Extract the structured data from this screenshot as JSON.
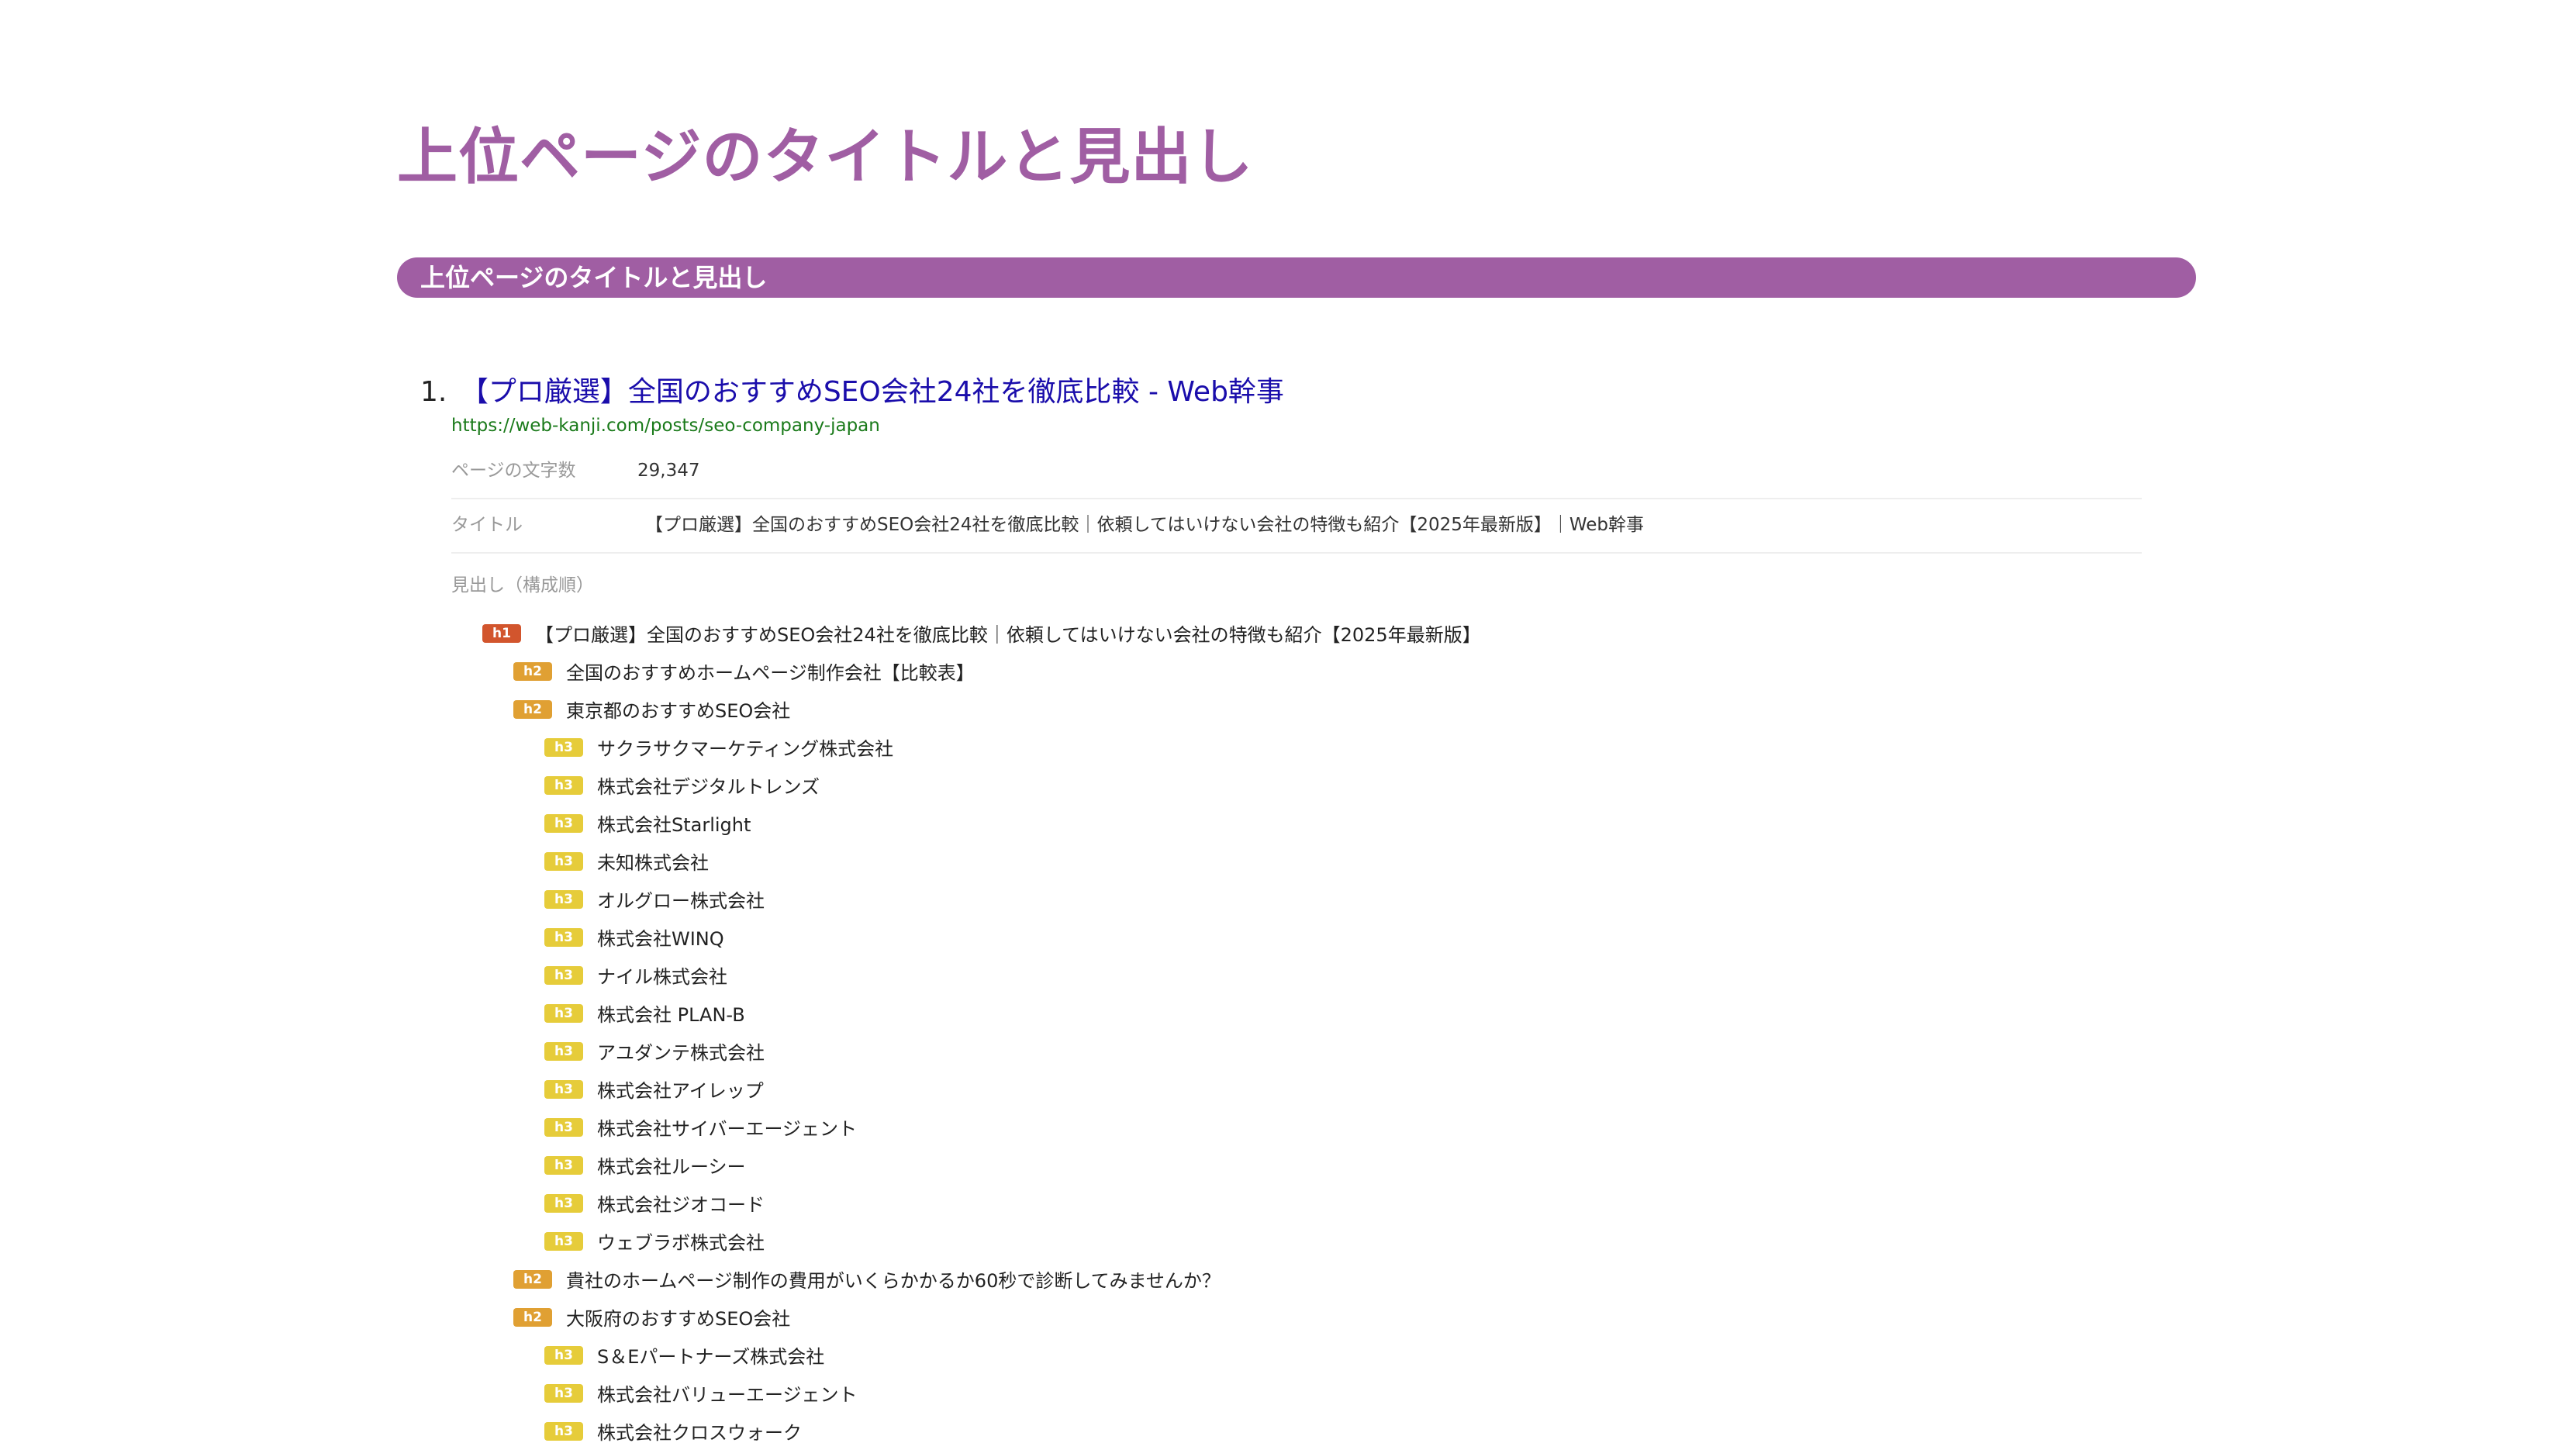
{
  "page": {
    "title": "上位ページのタイトルと見出し",
    "section_title": "上位ページのタイトルと見出し",
    "accent_color": "#a05ea3"
  },
  "results": [
    {
      "number": "1.",
      "title": "【プロ厳選】全国のおすすめSEO会社24社を徹底比較 - Web幹事",
      "url": "https://web-kanji.com/posts/seo-company-japan",
      "char_count_label": "ページの文字数",
      "char_count": "29,347",
      "page_title_label": "タイトル",
      "page_title": "【プロ厳選】全国のおすすめSEO会社24社を徹底比較｜依頼してはいけない会社の特徴も紹介【2025年最新版】｜Web幹事",
      "headings_label": "見出し（構成順）",
      "headings": [
        {
          "tag": "h1",
          "text": "【プロ厳選】全国のおすすめSEO会社24社を徹底比較｜依頼してはいけない会社の特徴も紹介【2025年最新版】"
        },
        {
          "tag": "h2",
          "text": "全国のおすすめホームページ制作会社【比較表】"
        },
        {
          "tag": "h2",
          "text": "東京都のおすすめSEO会社"
        },
        {
          "tag": "h3",
          "text": "サクラサクマーケティング株式会社"
        },
        {
          "tag": "h3",
          "text": "株式会社デジタルトレンズ"
        },
        {
          "tag": "h3",
          "text": "株式会社Starlight"
        },
        {
          "tag": "h3",
          "text": "未知株式会社"
        },
        {
          "tag": "h3",
          "text": "オルグロー株式会社"
        },
        {
          "tag": "h3",
          "text": "株式会社WINQ"
        },
        {
          "tag": "h3",
          "text": "ナイル株式会社"
        },
        {
          "tag": "h3",
          "text": "株式会社 PLAN-B"
        },
        {
          "tag": "h3",
          "text": "アユダンテ株式会社"
        },
        {
          "tag": "h3",
          "text": "株式会社アイレップ"
        },
        {
          "tag": "h3",
          "text": "株式会社サイバーエージェント"
        },
        {
          "tag": "h3",
          "text": "株式会社ルーシー"
        },
        {
          "tag": "h3",
          "text": "株式会社ジオコード"
        },
        {
          "tag": "h3",
          "text": "ウェブラボ株式会社"
        },
        {
          "tag": "h2",
          "text": "貴社のホームページ制作の費用がいくらかかるか60秒で診断してみませんか？"
        },
        {
          "tag": "h2",
          "text": "大阪府のおすすめSEO会社"
        },
        {
          "tag": "h3",
          "text": "S＆Eパートナーズ株式会社"
        },
        {
          "tag": "h3",
          "text": "株式会社バリューエージェント"
        },
        {
          "tag": "h3",
          "text": "株式会社クロスウォーク"
        }
      ]
    }
  ]
}
